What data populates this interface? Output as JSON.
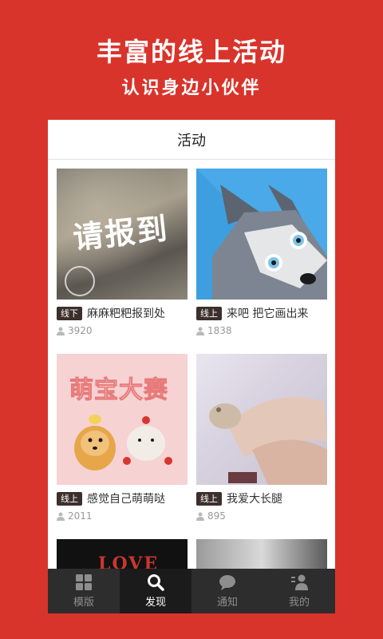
{
  "promo": {
    "title": "丰富的线上活动",
    "subtitle": "认识身边小伙伴"
  },
  "header": {
    "title": "活动"
  },
  "cards": [
    {
      "tag": "线下",
      "title": "麻麻粑粑报到处",
      "count": "3920",
      "image_text": "请报到"
    },
    {
      "tag": "线上",
      "title": "来吧 把它画出来",
      "count": "1838"
    },
    {
      "tag": "线上",
      "title": "感觉自己萌萌哒",
      "count": "2011",
      "image_text": "萌宝大赛"
    },
    {
      "tag": "线上",
      "title": "我爱大长腿",
      "count": "895"
    },
    {
      "image_text": "LOVE"
    },
    {}
  ],
  "tabbar": {
    "items": [
      {
        "label": "模版",
        "icon": "grid-icon"
      },
      {
        "label": "发现",
        "icon": "search-icon"
      },
      {
        "label": "通知",
        "icon": "chat-icon"
      },
      {
        "label": "我的",
        "icon": "profile-icon"
      }
    ],
    "active": "发现"
  },
  "colors": {
    "brand": "#d9342b",
    "tag": "#3c2f2c",
    "tabbar": "#2d2d2d"
  }
}
